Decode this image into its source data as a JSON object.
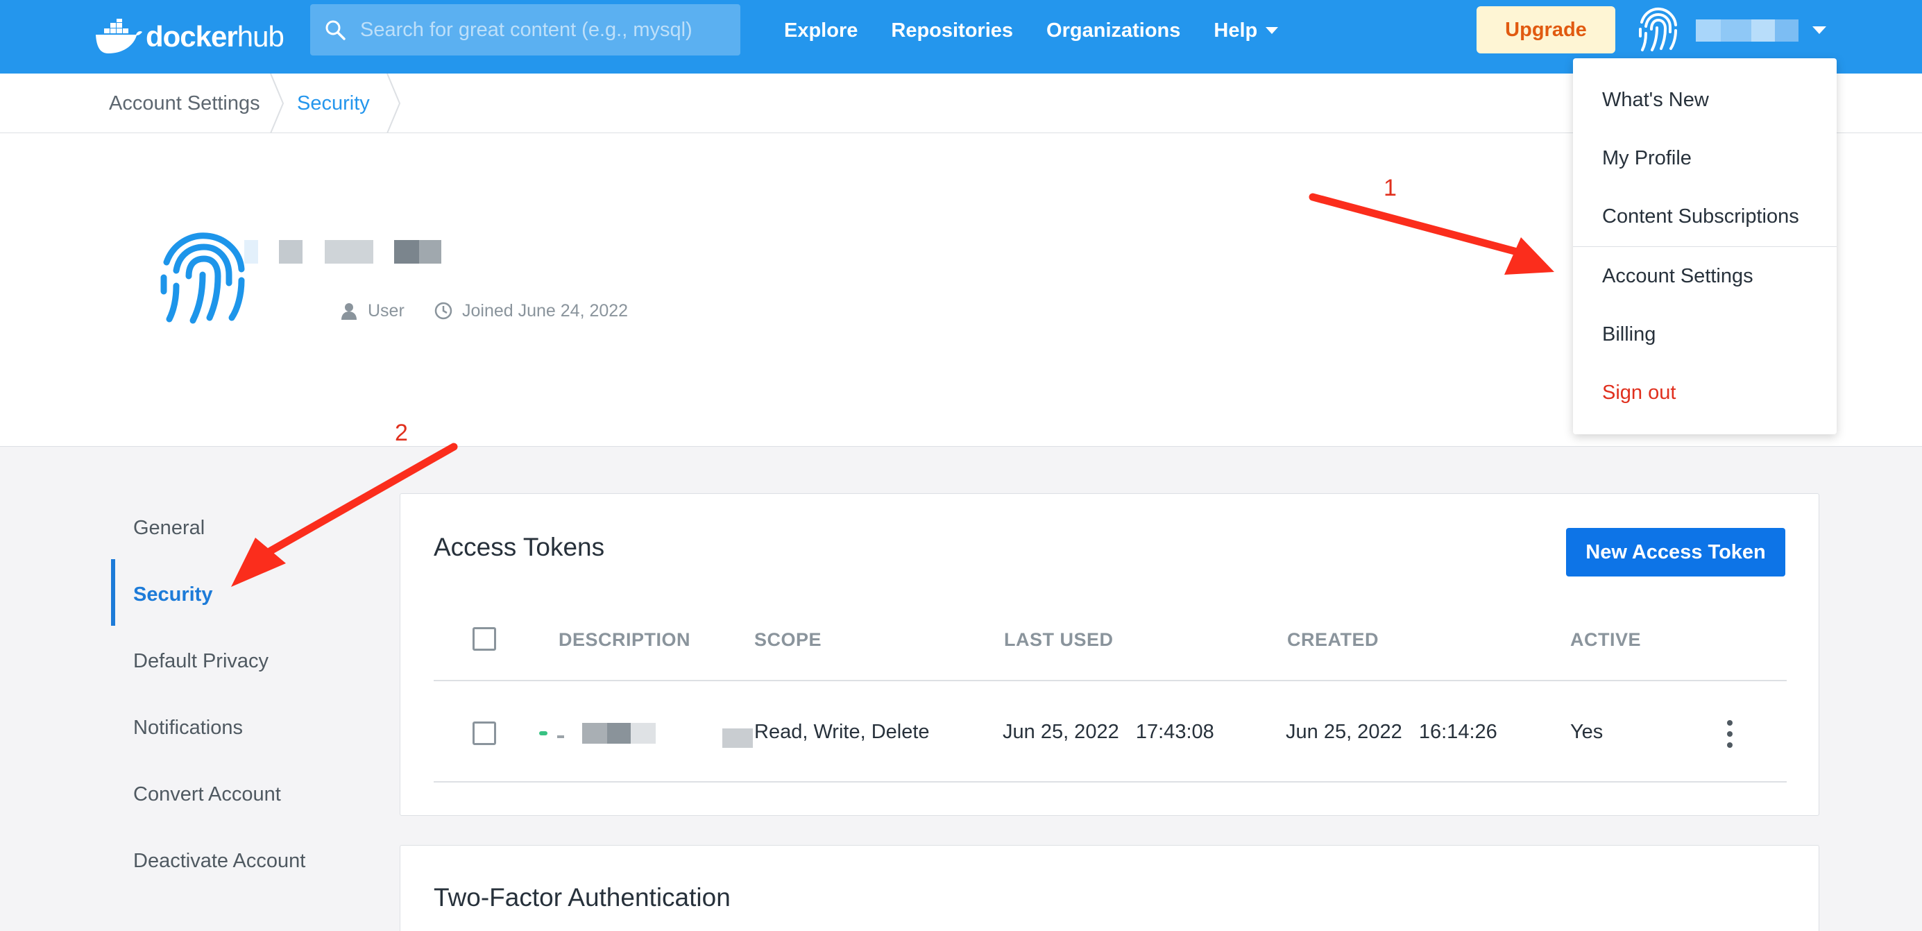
{
  "nav": {
    "logo_word": "docker",
    "logo_word_light": "hub",
    "search_placeholder": "Search for great content (e.g., mysql)",
    "links": [
      "Explore",
      "Repositories",
      "Organizations",
      "Help"
    ],
    "upgrade_label": "Upgrade"
  },
  "breadcrumb": [
    "Account Settings",
    "Security"
  ],
  "profile": {
    "role": "User",
    "joined": "Joined June 24, 2022"
  },
  "dropdown": {
    "items": [
      "What's New",
      "My Profile",
      "Content Subscriptions",
      "Account Settings",
      "Billing"
    ],
    "signout": "Sign out"
  },
  "side_menu": {
    "items": [
      "General",
      "Security",
      "Default Privacy",
      "Notifications",
      "Convert Account",
      "Deactivate Account"
    ],
    "active": "Security"
  },
  "tokens": {
    "title": "Access Tokens",
    "new_button": "New Access Token",
    "columns": [
      "DESCRIPTION",
      "SCOPE",
      "LAST USED",
      "CREATED",
      "ACTIVE"
    ],
    "rows": [
      {
        "scope": "Read, Write, Delete",
        "last_used": "Jun 25, 2022   17:43:08",
        "created": "Jun 25, 2022   16:14:26",
        "active": "Yes"
      }
    ]
  },
  "two_factor": {
    "title": "Two-Factor Authentication"
  },
  "annotations": [
    "1",
    "2"
  ],
  "colors": {
    "brand": "#2496ed",
    "primary_button": "#0d74e7",
    "upgrade_bg": "#fef5d4",
    "upgrade_text": "#e15a10",
    "signout": "#e0301e",
    "annotation": "#fb2d1c"
  }
}
